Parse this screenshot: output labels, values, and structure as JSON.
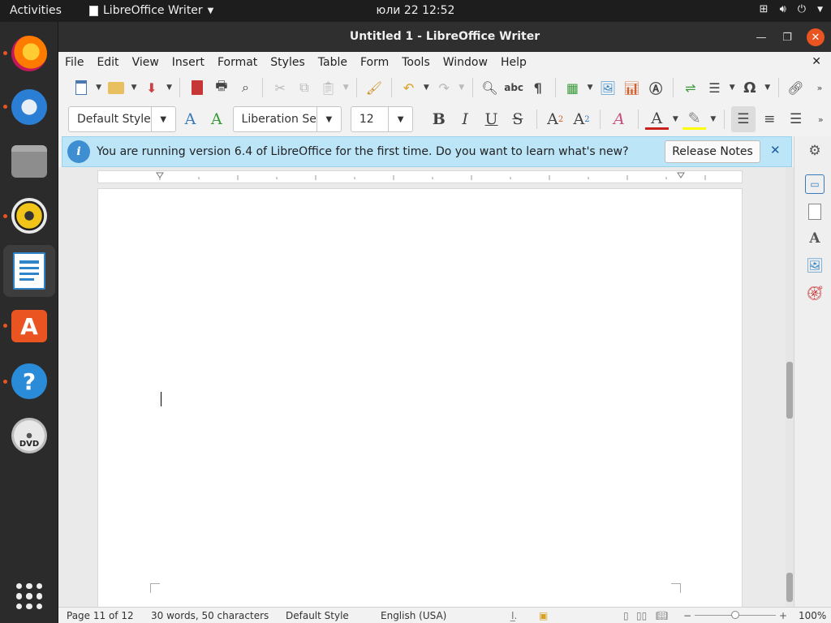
{
  "topbar": {
    "activities": "Activities",
    "app_name": "LibreOffice Writer",
    "clock": "юли 22  12:52"
  },
  "dock": {
    "items": [
      {
        "icon": "firefox-icon",
        "running": true,
        "color": "#e66000"
      },
      {
        "icon": "thunderbird-icon",
        "running": true,
        "color": "#2a7fd4"
      },
      {
        "icon": "files-icon",
        "running": false,
        "color": "#8a8a8a"
      },
      {
        "icon": "rhythmbox-icon",
        "running": true,
        "color": "#f0c419"
      },
      {
        "icon": "libreoffice-writer-icon",
        "running": false,
        "active": true,
        "color": "#2e84c6"
      },
      {
        "icon": "ubuntu-software-icon",
        "running": true,
        "color": "#e95420"
      },
      {
        "icon": "help-icon",
        "running": true,
        "color": "#2a8bd9"
      },
      {
        "icon": "dvd-icon",
        "running": false,
        "color": "#d8d8d8"
      }
    ]
  },
  "window": {
    "title": "Untitled 1 - LibreOffice Writer"
  },
  "menu": {
    "items": [
      "File",
      "Edit",
      "View",
      "Insert",
      "Format",
      "Styles",
      "Table",
      "Form",
      "Tools",
      "Window",
      "Help"
    ]
  },
  "formatting": {
    "paragraph_style": "Default Style",
    "font_name": "Liberation Se",
    "font_size": "12"
  },
  "infobar": {
    "message": "You are running version 6.4 of LibreOffice for the first time. Do you want to learn what's new?",
    "button": "Release Notes"
  },
  "status": {
    "page": "Page 11 of 12",
    "words": "30 words, 50 characters",
    "page_style": "Default Style",
    "language": "English (USA)",
    "zoom": "100%"
  },
  "colors": {
    "accent": "#e95420",
    "infobar_bg": "#bde5f8",
    "titlebar_bg": "#2f2f2f"
  }
}
